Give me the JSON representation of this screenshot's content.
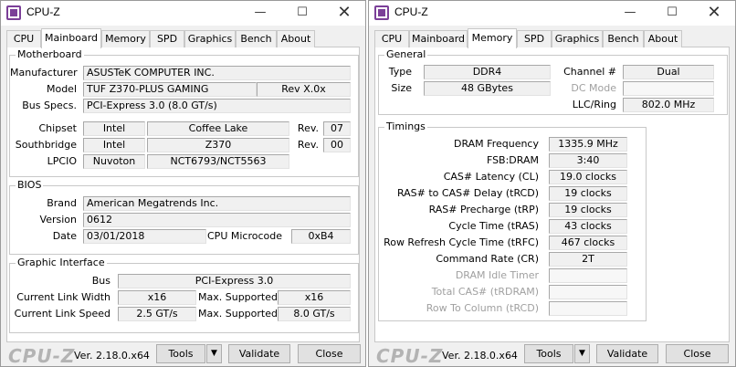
{
  "win1": {
    "title": "CPU-Z",
    "tabs": [
      "CPU",
      "Mainboard",
      "Memory",
      "SPD",
      "Graphics",
      "Bench",
      "About"
    ],
    "motherboard": {
      "legend": "Motherboard",
      "manufacturer_label": "Manufacturer",
      "manufacturer": "ASUSTeK COMPUTER INC.",
      "model_label": "Model",
      "model": "TUF Z370-PLUS GAMING",
      "model_rev": "Rev X.0x",
      "busspecs_label": "Bus Specs.",
      "busspecs": "PCI-Express 3.0 (8.0 GT/s)",
      "chipset_label": "Chipset",
      "chipset_vendor": "Intel",
      "chipset_name": "Coffee Lake",
      "chipset_rev_label": "Rev.",
      "chipset_rev": "07",
      "southbridge_label": "Southbridge",
      "southbridge_vendor": "Intel",
      "southbridge_name": "Z370",
      "southbridge_rev_label": "Rev.",
      "southbridge_rev": "00",
      "lpcio_label": "LPCIO",
      "lpcio_vendor": "Nuvoton",
      "lpcio_name": "NCT6793/NCT5563"
    },
    "bios": {
      "legend": "BIOS",
      "brand_label": "Brand",
      "brand": "American Megatrends Inc.",
      "version_label": "Version",
      "version": "0612",
      "date_label": "Date",
      "date": "03/01/2018",
      "microcode_label": "CPU Microcode",
      "microcode": "0xB4"
    },
    "graphic": {
      "legend": "Graphic Interface",
      "bus_label": "Bus",
      "bus": "PCI-Express 3.0",
      "width_label": "Current Link Width",
      "width": "x16",
      "maxw_label": "Max. Supported",
      "maxw": "x16",
      "speed_label": "Current Link Speed",
      "speed": "2.5 GT/s",
      "maxs_label": "Max. Supported",
      "maxs": "8.0 GT/s"
    }
  },
  "win2": {
    "title": "CPU-Z",
    "tabs": [
      "CPU",
      "Mainboard",
      "Memory",
      "SPD",
      "Graphics",
      "Bench",
      "About"
    ],
    "general": {
      "legend": "General",
      "type_label": "Type",
      "type": "DDR4",
      "size_label": "Size",
      "size": "48 GBytes",
      "channel_label": "Channel #",
      "channel": "Dual",
      "dcmode_label": "DC Mode",
      "dcmode": "",
      "llc_label": "LLC/Ring",
      "llc": "802.0 MHz"
    },
    "timings": {
      "legend": "Timings",
      "rows": [
        {
          "label": "DRAM Frequency",
          "value": "1335.9 MHz"
        },
        {
          "label": "FSB:DRAM",
          "value": "3:40"
        },
        {
          "label": "CAS# Latency (CL)",
          "value": "19.0 clocks"
        },
        {
          "label": "RAS# to CAS# Delay (tRCD)",
          "value": "19 clocks"
        },
        {
          "label": "RAS# Precharge (tRP)",
          "value": "19 clocks"
        },
        {
          "label": "Cycle Time (tRAS)",
          "value": "43 clocks"
        },
        {
          "label": "Row Refresh Cycle Time (tRFC)",
          "value": "467 clocks"
        },
        {
          "label": "Command Rate (CR)",
          "value": "2T"
        },
        {
          "label": "DRAM Idle Timer",
          "value": ""
        },
        {
          "label": "Total CAS# (tRDRAM)",
          "value": ""
        },
        {
          "label": "Row To Column (tRCD)",
          "value": ""
        }
      ]
    }
  },
  "footer": {
    "logo": "CPU-Z",
    "version": "Ver. 2.18.0.x64",
    "tools": "Tools",
    "validate": "Validate",
    "close": "Close"
  },
  "icons": {
    "minimize": "minimize-icon",
    "maximize": "maximize-icon",
    "close": "close-icon",
    "dropdown": "dropdown-arrow-icon",
    "app": "cpu-z-app-icon"
  },
  "colors": {
    "accent": "#7b3f98"
  }
}
